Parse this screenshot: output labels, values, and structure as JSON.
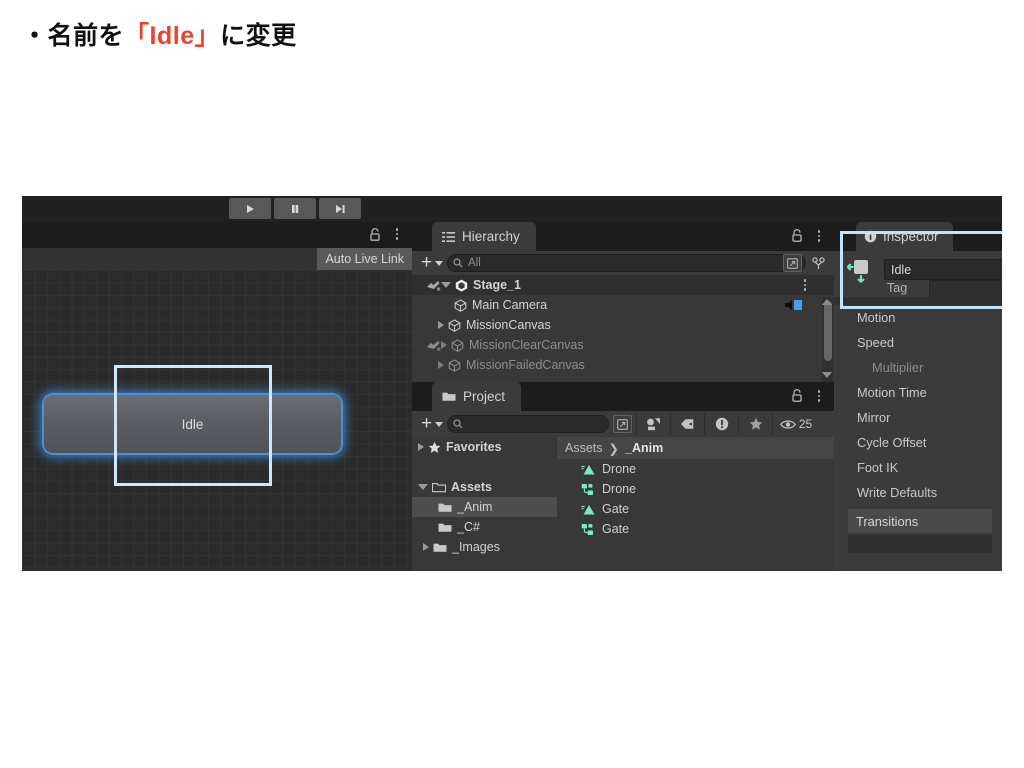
{
  "slide": {
    "bullet": "・",
    "text_before": "名前を",
    "accent": "「Idle」",
    "text_after": "に変更"
  },
  "toolbar": {
    "play_label": "Play",
    "pause_label": "Pause",
    "step_label": "Step"
  },
  "animator": {
    "auto_live_link": "Auto Live Link",
    "state_node_label": "Idle"
  },
  "hierarchy": {
    "tab_label": "Hierarchy",
    "add_label": "+",
    "search_placeholder": "All",
    "items": [
      {
        "label": "Stage_1",
        "depth": 0,
        "dim": false,
        "root": true,
        "expanded": true
      },
      {
        "label": "Main Camera",
        "depth": 1,
        "dim": false,
        "root": false,
        "expanded": null
      },
      {
        "label": "MissionCanvas",
        "depth": 1,
        "dim": false,
        "root": false,
        "expanded": false
      },
      {
        "label": "MissionClearCanvas",
        "depth": 1,
        "dim": true,
        "root": false,
        "expanded": false
      },
      {
        "label": "MissionFailedCanvas",
        "depth": 1,
        "dim": true,
        "root": false,
        "expanded": false
      }
    ]
  },
  "project": {
    "tab_label": "Project",
    "add_label": "+",
    "search_placeholder": "",
    "visible_count": "25",
    "tree": [
      {
        "label": "Favorites",
        "type": "star",
        "depth": 0,
        "selected": false,
        "arrow": "closed"
      },
      {
        "label": "",
        "type": "spacer",
        "depth": 0,
        "selected": false,
        "arrow": "none"
      },
      {
        "label": "Assets",
        "type": "folder-open",
        "depth": 0,
        "selected": false,
        "arrow": "open"
      },
      {
        "label": "_Anim",
        "type": "folder",
        "depth": 1,
        "selected": true,
        "arrow": "none"
      },
      {
        "label": "_C#",
        "type": "folder",
        "depth": 1,
        "selected": false,
        "arrow": "none"
      },
      {
        "label": "_Images",
        "type": "folder",
        "depth": 1,
        "selected": false,
        "arrow": "closed"
      }
    ],
    "breadcrumb_root": "Assets",
    "breadcrumb_sep": "❯",
    "breadcrumb_current": "_Anim",
    "assets": [
      {
        "label": "Drone",
        "type": "animation-clip"
      },
      {
        "label": "Drone",
        "type": "animator-controller"
      },
      {
        "label": "Gate",
        "type": "animation-clip"
      },
      {
        "label": "Gate",
        "type": "animator-controller"
      }
    ]
  },
  "inspector": {
    "tab_label": "Inspector",
    "name_value": "Idle",
    "tag_label": "Tag",
    "properties": [
      {
        "label": "Motion",
        "dim": false
      },
      {
        "label": "Speed",
        "dim": false
      },
      {
        "label": "Multiplier",
        "dim": true
      },
      {
        "label": "Motion Time",
        "dim": false
      },
      {
        "label": "Mirror",
        "dim": false
      },
      {
        "label": "Cycle Offset",
        "dim": false
      },
      {
        "label": "Foot IK",
        "dim": false
      },
      {
        "label": "Write Defaults",
        "dim": false
      }
    ],
    "transitions_label": "Transitions"
  },
  "colors": {
    "accent_red": "#e8442b",
    "highlight_blue": "#bfe3f7",
    "node_glow": "#4a8fd8",
    "asset_teal": "#7ce8c8"
  }
}
